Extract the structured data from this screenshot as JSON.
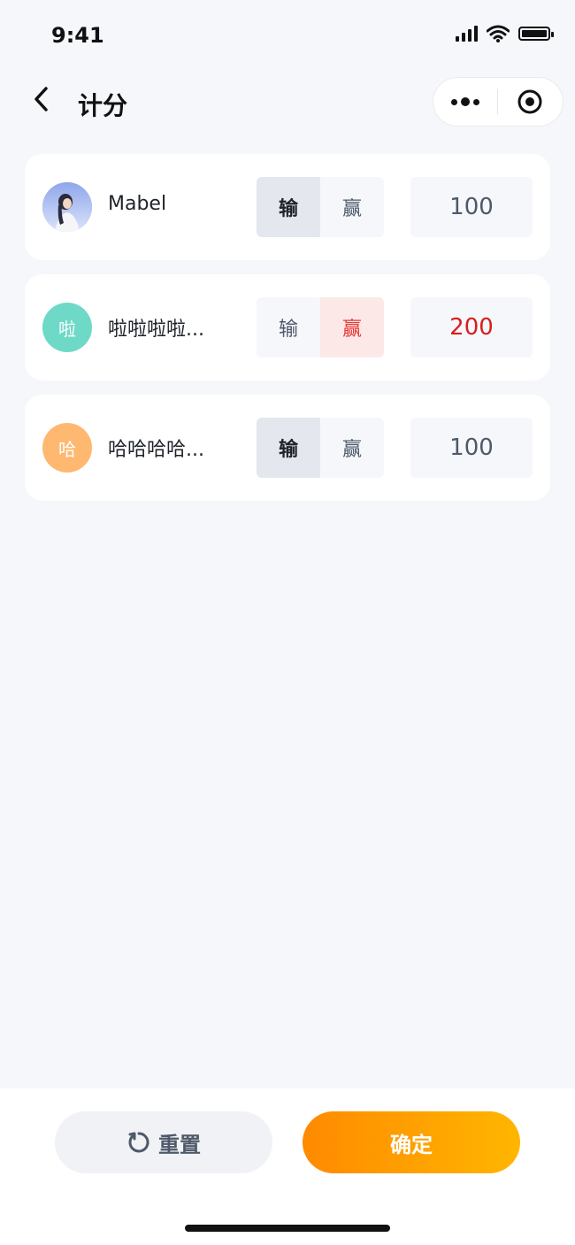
{
  "status_bar": {
    "time": "9:41"
  },
  "nav": {
    "title": "计分"
  },
  "players": [
    {
      "name": "Mabel",
      "avatar_type": "photo",
      "avatar_letter": "",
      "avatar_color": "#7f9be0",
      "lose_label": "输",
      "win_label": "赢",
      "selected": "lose",
      "score": "100"
    },
    {
      "name": "啦啦啦啦...",
      "avatar_type": "letter",
      "avatar_letter": "啦",
      "avatar_color": "#6ed9c6",
      "lose_label": "输",
      "win_label": "赢",
      "selected": "win",
      "score": "200"
    },
    {
      "name": "哈哈哈哈...",
      "avatar_type": "letter",
      "avatar_letter": "哈",
      "avatar_color": "#ffb870",
      "lose_label": "输",
      "win_label": "赢",
      "selected": "lose",
      "score": "100"
    }
  ],
  "actions": {
    "reset_label": "重置",
    "confirm_label": "确定"
  },
  "colors": {
    "accent_start": "#ff8a00",
    "accent_end": "#ffb600",
    "win": "#e53935",
    "background": "#f6f7fb"
  },
  "icons": {
    "back": "chevron-left-icon",
    "more": "more-dots-icon",
    "target": "target-icon",
    "reset": "refresh-icon"
  }
}
